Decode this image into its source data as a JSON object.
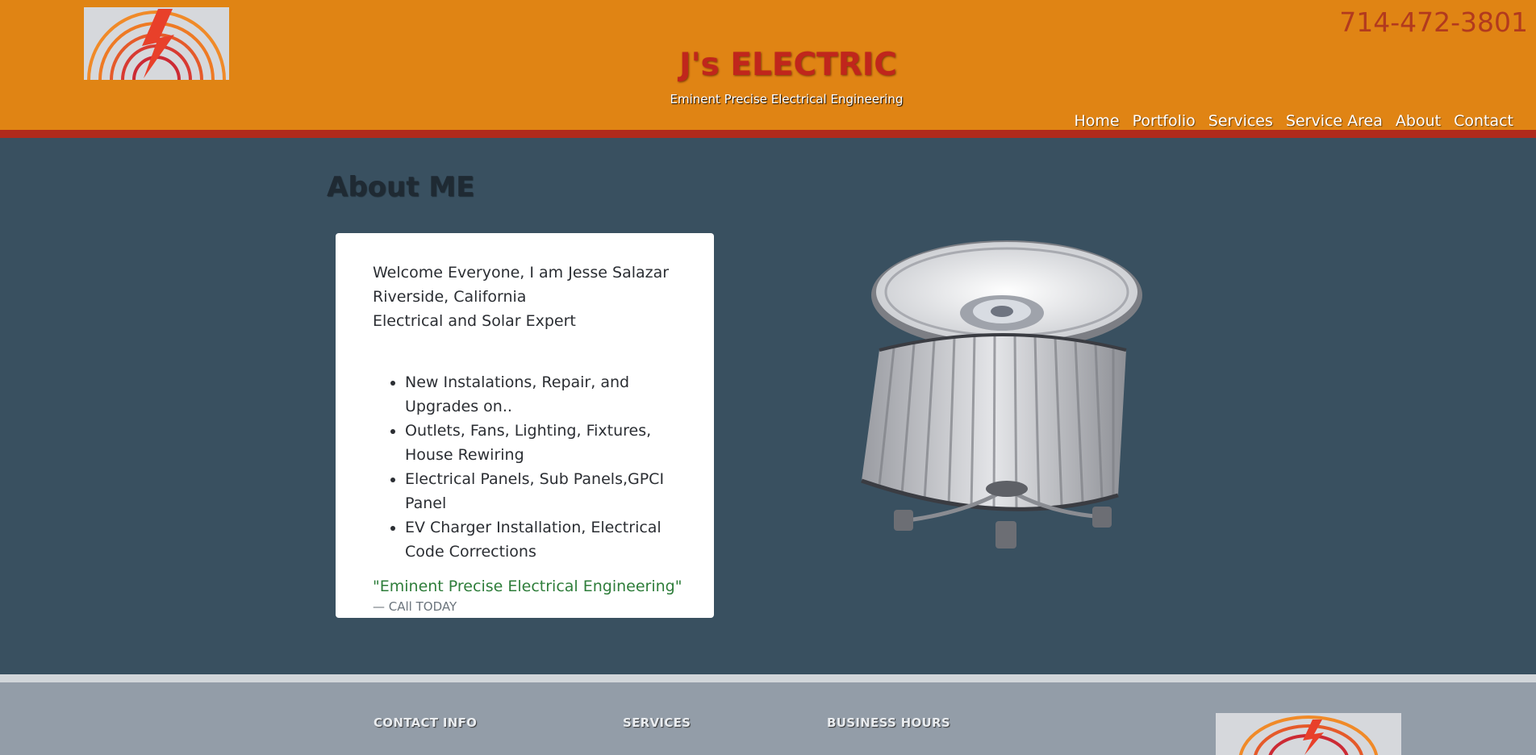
{
  "header": {
    "phone": "714-472-3801",
    "brand": "J's ELECTRIC",
    "tagline": "Eminent Precise Electrical Engineering",
    "nav": [
      "Home",
      "Portfolio",
      "Services",
      "Service Area",
      "About",
      "Contact"
    ]
  },
  "main": {
    "title": "About ME",
    "intro": [
      "Welcome Everyone, I am Jesse Salazar",
      "Riverside, California",
      "Electrical and Solar Expert"
    ],
    "services": [
      "New Instalations, Repair, and Upgrades on..",
      "Outlets, Fans, Lighting, Fixtures, House Rewiring",
      "Electrical Panels, Sub Panels,GPCI Panel",
      "EV Charger Installation, Electrical Code Corrections"
    ],
    "quote": "\"Eminent Precise Electrical Engineering\"",
    "cite": "— CAll TODAY"
  },
  "footer": {
    "headings": [
      "CONTACT INFO",
      "SERVICES",
      "BUSINESS HOURS"
    ]
  },
  "colors": {
    "header_bg": "#E08414",
    "header_stripe": "#B02A1C",
    "page_bg": "#395060",
    "footer_bg": "#939DA8",
    "quote_green": "#2E7D3A"
  },
  "icons": {
    "logo": "lightning-bolt-rainbow-logo",
    "lamp": "drum-shade-ceiling-lamp"
  }
}
